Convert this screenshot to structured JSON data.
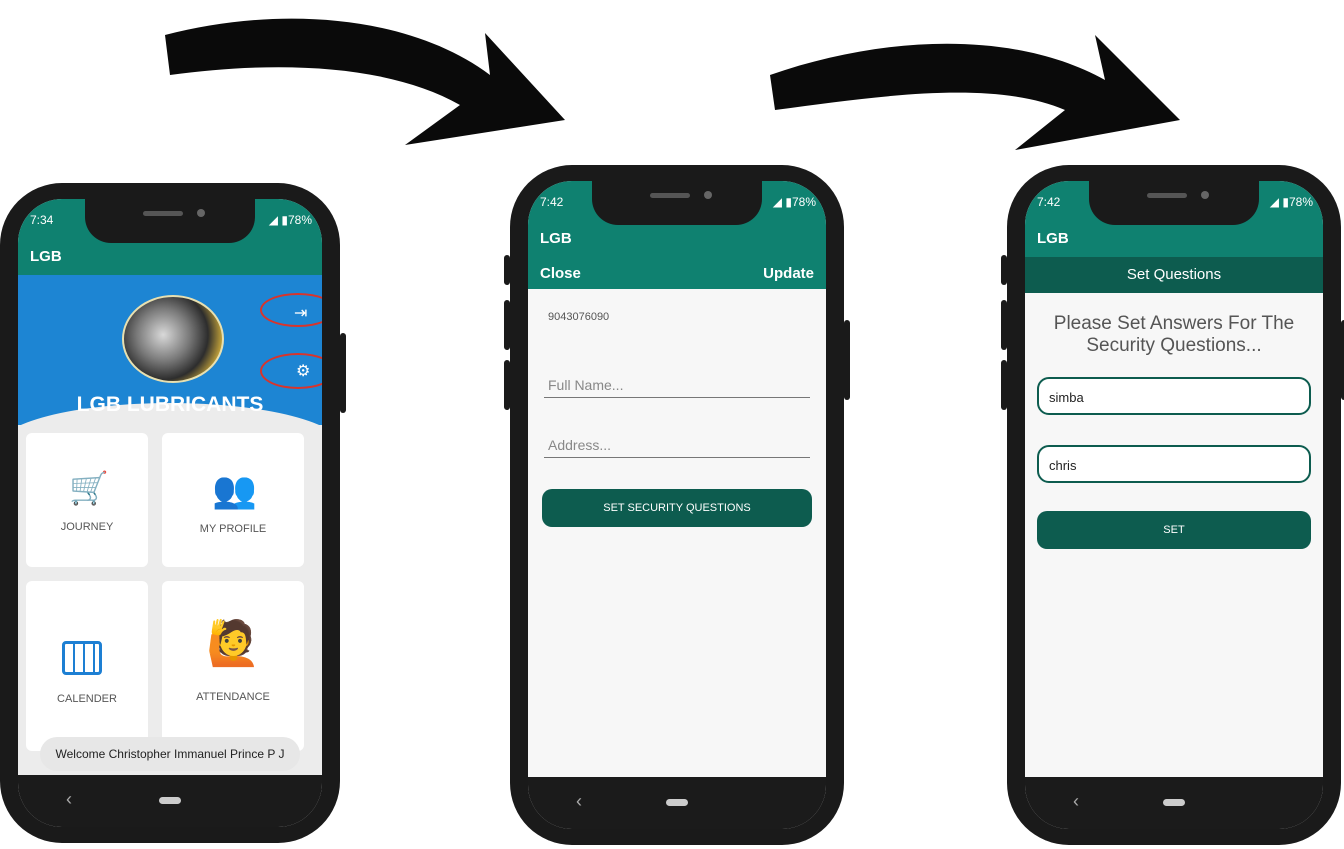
{
  "phones": [
    {
      "status_time": "7:34",
      "status_battery": "78%",
      "app_title": "LGB",
      "hero_title": "LGB LUBRICANTS",
      "tiles": [
        {
          "label": "JOURNEY",
          "icon": "delivery-cart-icon"
        },
        {
          "label": "MY PROFILE",
          "icon": "users-icon"
        },
        {
          "label": "CALENDER",
          "icon": "calendar-icon"
        },
        {
          "label": "ATTENDANCE",
          "icon": "waving-person-icon"
        }
      ],
      "toast": "Welcome Christopher Immanuel Prince P J"
    },
    {
      "status_time": "7:42",
      "status_battery": "78%",
      "app_title": "LGB",
      "close_label": "Close",
      "update_label": "Update",
      "phone_number": "9043076090",
      "full_name_placeholder": "Full Name...",
      "address_placeholder": "Address...",
      "security_button": "SET SECURITY QUESTIONS"
    },
    {
      "status_time": "7:42",
      "status_battery": "78%",
      "app_title": "LGB",
      "header": "Set Questions",
      "prompt": "Please Set Answers For The Security Questions...",
      "answer1": "simba",
      "answer2": "chris",
      "set_button": "SET"
    }
  ],
  "colors": {
    "primary": "#0f8170",
    "dark": "#0d5c4f",
    "hero": "#1d85d3",
    "highlight": "#d9342b"
  }
}
